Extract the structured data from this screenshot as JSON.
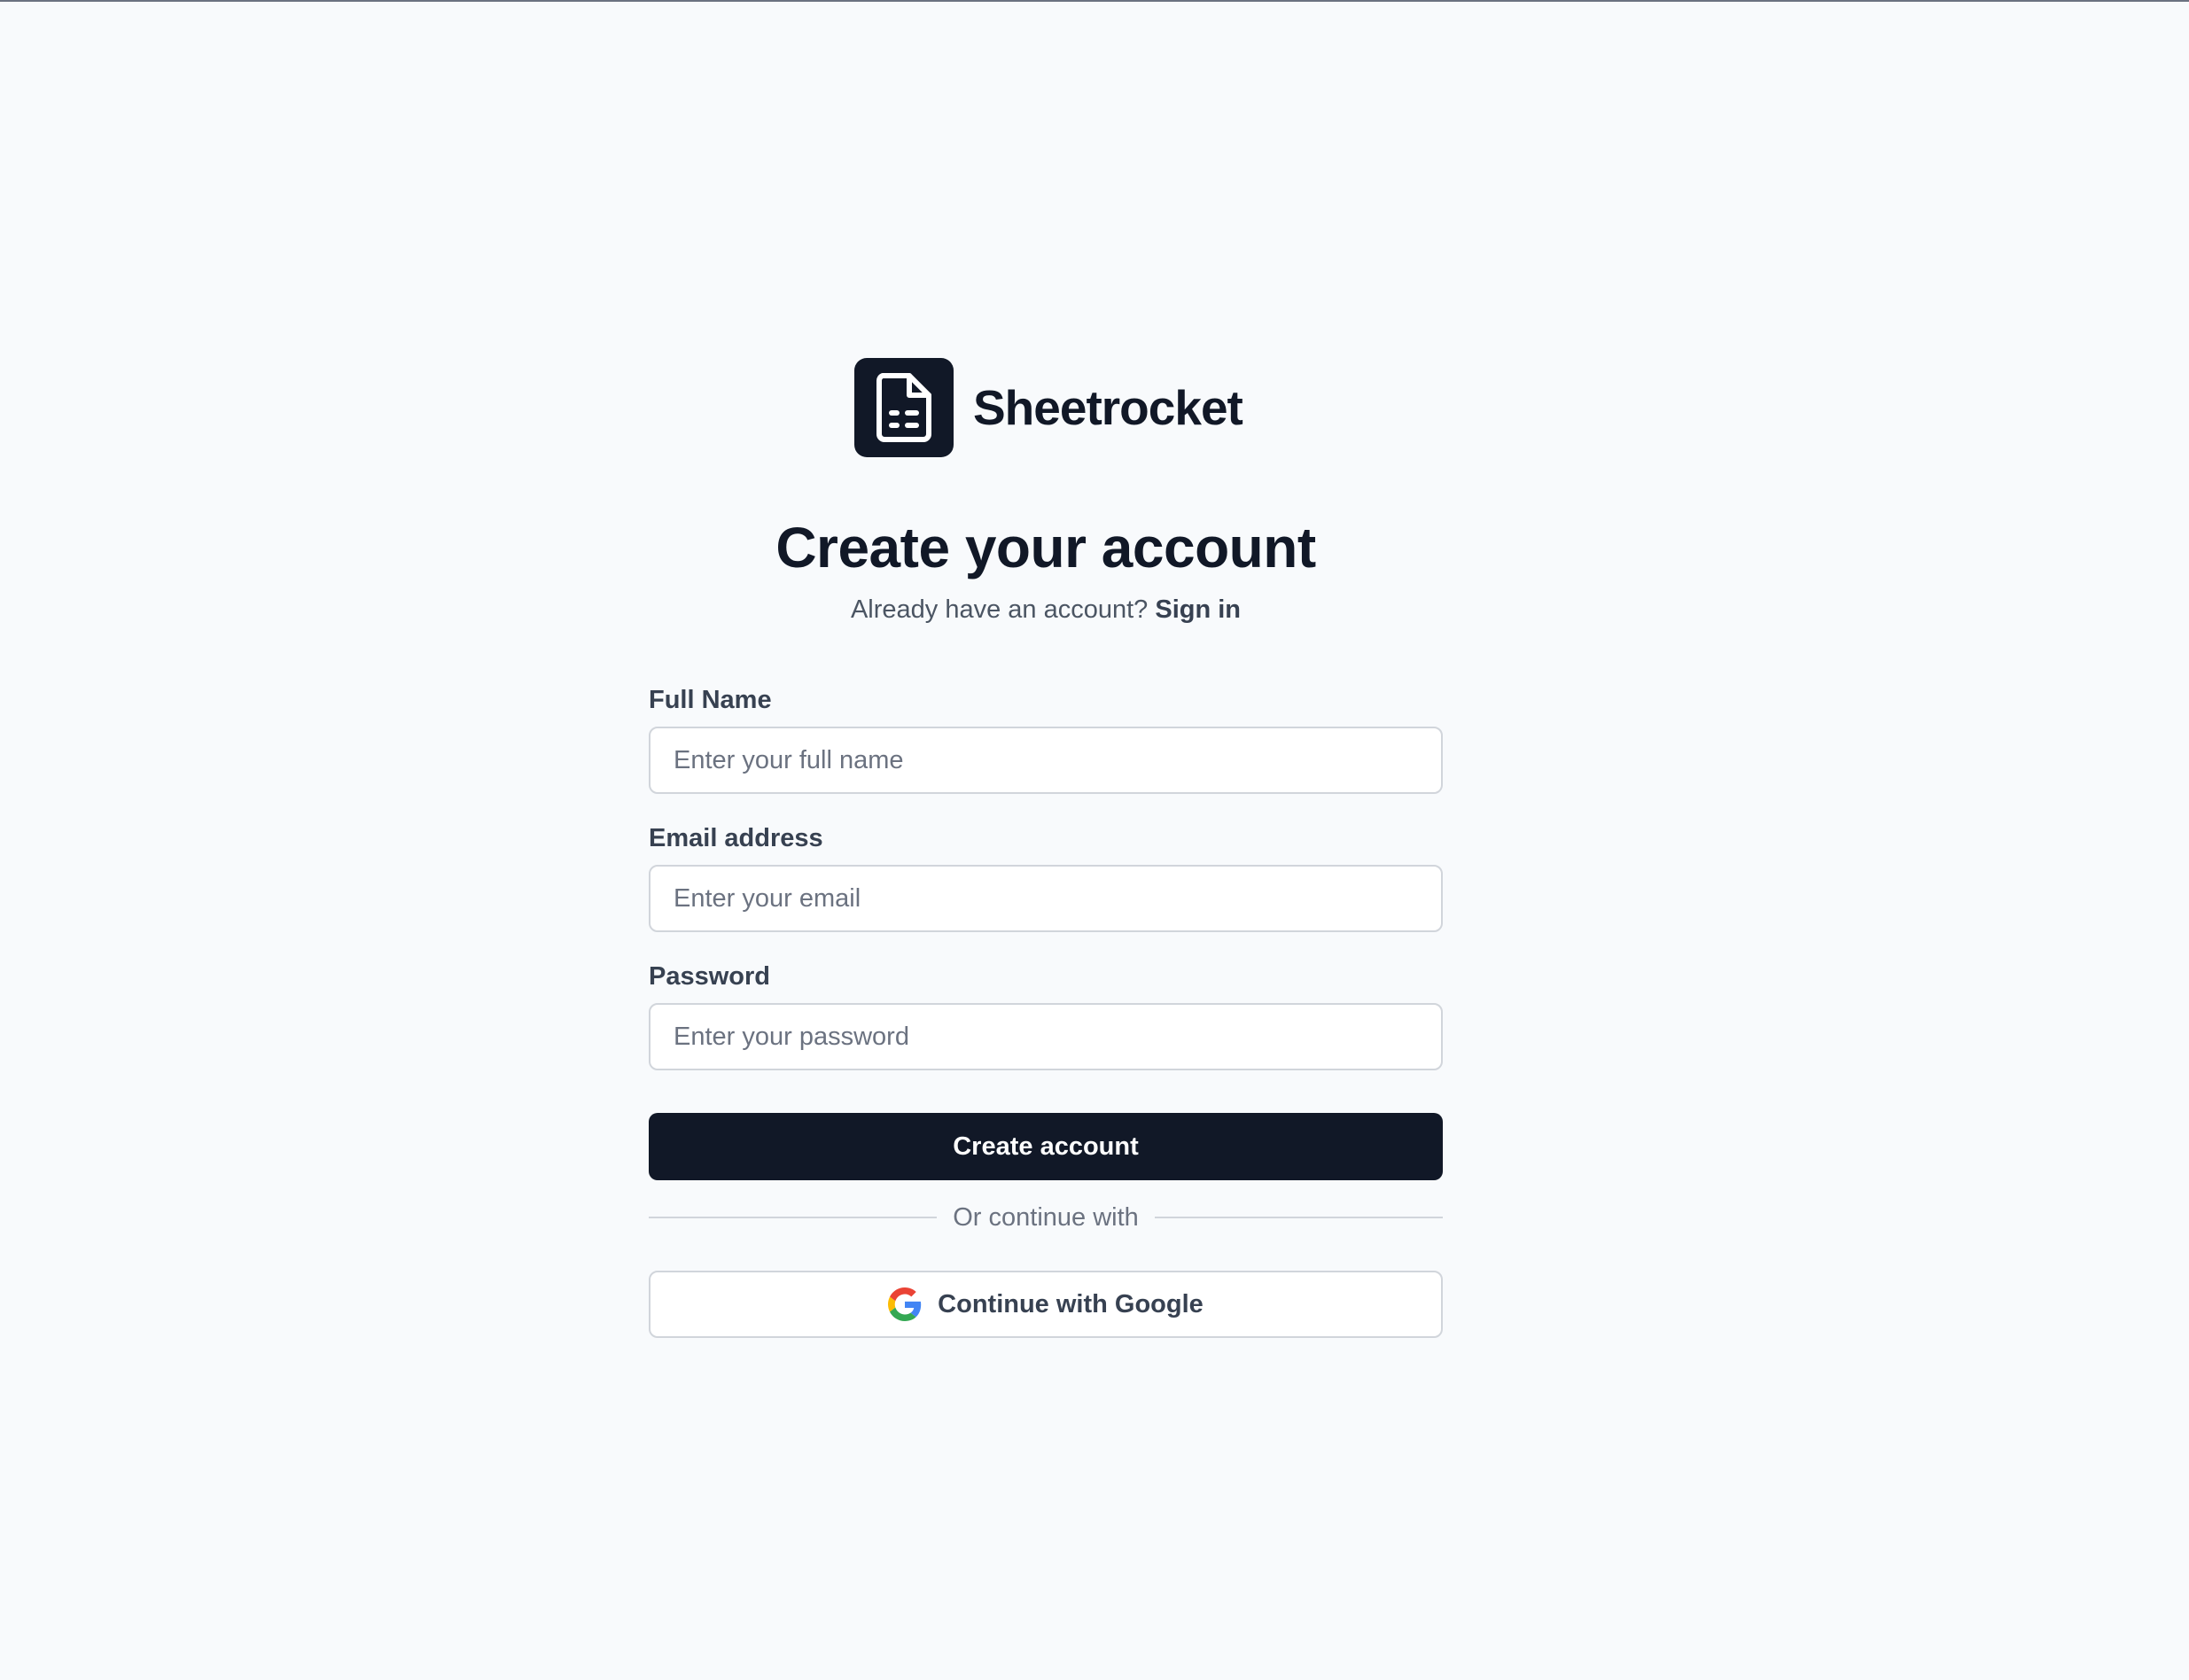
{
  "brand": {
    "name": "Sheetrocket",
    "logo_icon": "document-sheet-icon"
  },
  "heading": "Create your account",
  "subline": {
    "prompt": "Already have an account?",
    "link": "Sign in"
  },
  "form": {
    "full_name": {
      "label": "Full Name",
      "placeholder": "Enter your full name",
      "value": ""
    },
    "email": {
      "label": "Email address",
      "placeholder": "Enter your email",
      "value": ""
    },
    "password": {
      "label": "Password",
      "placeholder": "Enter your password",
      "value": ""
    },
    "submit_label": "Create account",
    "divider_text": "Or continue with",
    "google_label": "Continue with Google",
    "google_icon": "google-icon"
  },
  "colors": {
    "background": "#f8fafc",
    "primary": "#111827",
    "border": "#d1d5db",
    "muted_text": "#6b7280"
  }
}
